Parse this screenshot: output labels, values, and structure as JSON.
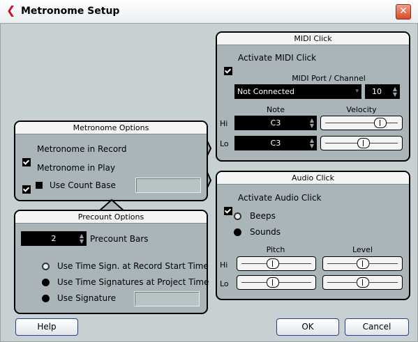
{
  "window": {
    "title": "Metronome Setup",
    "close_glyph": "✕",
    "logo_glyph": "❮"
  },
  "midi_click": {
    "header": "MIDI Click",
    "activate_label": "Activate MIDI Click",
    "port_channel_label": "MIDI Port / Channel",
    "port_value": "Not Connected",
    "channel_value": "10",
    "note_label": "Note",
    "velocity_label": "Velocity",
    "hi_label": "Hi",
    "lo_label": "Lo",
    "hi_note": "C3",
    "lo_note": "C3",
    "hi_velocity": 0.78,
    "lo_velocity": 0.53
  },
  "metronome_options": {
    "header": "Metronome Options",
    "in_record_label": "Metronome in Record",
    "in_play_label": "Metronome in Play",
    "count_base_label": "Use Count Base"
  },
  "audio_click": {
    "header": "Audio Click",
    "activate_label": "Activate Audio Click",
    "beeps_label": "Beeps",
    "sounds_label": "Sounds",
    "pitch_label": "Pitch",
    "level_label": "Level",
    "hi_label": "Hi",
    "lo_label": "Lo",
    "hi_pitch": 0.45,
    "lo_pitch": 0.45,
    "hi_level": 0.5,
    "lo_level": 0.5
  },
  "precount_options": {
    "header": "Precount Options",
    "bars_value": "2",
    "bars_label": "Precount Bars",
    "opt_record_start": "Use Time Sign. at Record Start Time",
    "opt_project_time": "Use Time Signatures at Project Time",
    "opt_use_signature": "Use Signature"
  },
  "buttons": {
    "help": "Help",
    "ok": "OK",
    "cancel": "Cancel"
  }
}
